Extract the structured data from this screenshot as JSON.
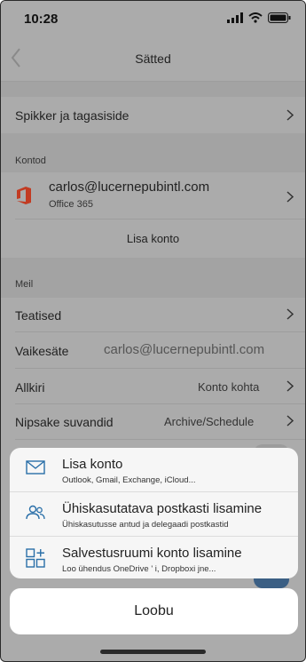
{
  "status_bar": {
    "time": "10:28"
  },
  "nav": {
    "title": "Sätted"
  },
  "help_row": {
    "label": "Spikker ja tagasiside"
  },
  "accounts": {
    "section_label": "Kontod",
    "email": "carlos@lucernepubintl.com",
    "type": "Office 365",
    "add_account": "Lisa konto"
  },
  "mail": {
    "section_label": "Meil",
    "notifications": "Teatised",
    "default_label": "Vaikesäte",
    "default_value": "carlos@lucernepubintl.com",
    "signature_label": "Allkiri",
    "signature_value": "Konto kohta",
    "swipe_label": "Nipsake suvandid",
    "swipe_value": "Archive/Schedule"
  },
  "sheet": {
    "items": [
      {
        "title": "Lisa konto",
        "subtitle": "Outlook, Gmail, Exchange, iCloud...",
        "icon": "envelope-icon"
      },
      {
        "title": "Ühiskasutatava postkasti lisamine",
        "subtitle": "Ühiskasutusse antud ja delegaadi postkastid",
        "icon": "people-icon"
      },
      {
        "title": "Salvestusruumi konto lisamine",
        "subtitle": "Loo ühendus OneDrive ' i, Dropboxi jne...",
        "icon": "grid-plus-icon"
      }
    ],
    "cancel": "Loobu"
  },
  "colors": {
    "accent": "#2a6fa8",
    "office_red": "#c23b22",
    "overlay_gray": "#ababab"
  }
}
